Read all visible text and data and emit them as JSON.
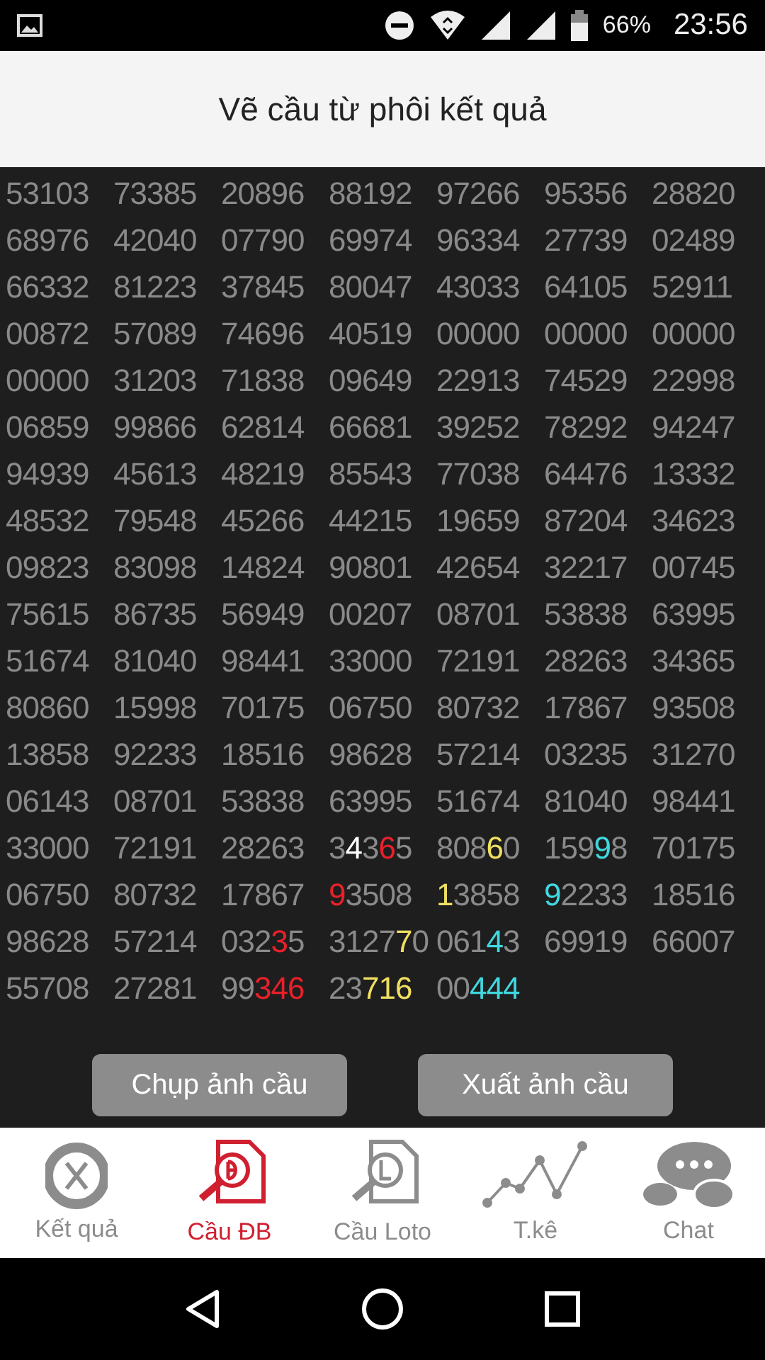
{
  "status_bar": {
    "battery": "66%",
    "time": "23:56"
  },
  "header": {
    "title": "Vẽ cầu từ phôi kết quả"
  },
  "grid": {
    "rows": [
      [
        "53103",
        "73385",
        "20896",
        "88192",
        "97266",
        "95356",
        "28820"
      ],
      [
        "68976",
        "42040",
        "07790",
        "69974",
        "96334",
        "27739",
        "02489"
      ],
      [
        "66332",
        "81223",
        "37845",
        "80047",
        "43033",
        "64105",
        "52911"
      ],
      [
        "00872",
        "57089",
        "74696",
        "40519",
        "00000",
        "00000",
        "00000"
      ],
      [
        "00000",
        "31203",
        "71838",
        "09649",
        "22913",
        "74529",
        "22998"
      ],
      [
        "06859",
        "99866",
        "62814",
        "66681",
        "39252",
        "78292",
        "94247"
      ],
      [
        "94939",
        "45613",
        "48219",
        "85543",
        "77038",
        "64476",
        "13332"
      ],
      [
        "48532",
        "79548",
        "45266",
        "44215",
        "19659",
        "87204",
        "34623"
      ],
      [
        "09823",
        "83098",
        "14824",
        "90801",
        "42654",
        "32217",
        "00745"
      ],
      [
        "75615",
        "86735",
        "56949",
        "00207",
        "08701",
        "53838",
        "63995"
      ],
      [
        "51674",
        "81040",
        "98441",
        "33000",
        "72191",
        "28263",
        "34365"
      ],
      [
        "80860",
        "15998",
        "70175",
        "06750",
        "80732",
        "17867",
        "93508"
      ],
      [
        "13858",
        "92233",
        "18516",
        "98628",
        "57214",
        "03235",
        "31270"
      ],
      [
        "06143",
        "08701",
        "53838",
        "63995",
        "51674",
        "81040",
        "98441"
      ],
      [
        "33000",
        "72191",
        "28263",
        {
          "parts": [
            {
              "text": "3"
            },
            {
              "text": "4",
              "color": "#ffffff"
            },
            {
              "text": "3"
            },
            {
              "text": "6",
              "color": "#e8202a"
            },
            {
              "text": "5"
            }
          ]
        },
        {
          "parts": [
            {
              "text": "808"
            },
            {
              "text": "6",
              "color": "#f0e060"
            },
            {
              "text": "0"
            }
          ]
        },
        {
          "parts": [
            {
              "text": "159"
            },
            {
              "text": "9",
              "color": "#40d8e0"
            },
            {
              "text": "8"
            }
          ]
        },
        "70175"
      ],
      [
        "06750",
        "80732",
        "17867",
        {
          "parts": [
            {
              "text": "9",
              "color": "#e8202a"
            },
            {
              "text": "3508"
            }
          ]
        },
        {
          "parts": [
            {
              "text": "1",
              "color": "#f0e060"
            },
            {
              "text": "3858"
            }
          ]
        },
        {
          "parts": [
            {
              "text": "9",
              "color": "#40d8e0"
            },
            {
              "text": "2233"
            }
          ]
        },
        "18516"
      ],
      [
        "98628",
        "57214",
        {
          "parts": [
            {
              "text": "032"
            },
            {
              "text": "3",
              "color": "#e8202a"
            },
            {
              "text": "5"
            }
          ]
        },
        {
          "parts": [
            {
              "text": "3127"
            },
            {
              "text": "7",
              "color": "#f0e060"
            },
            {
              "text": "0"
            }
          ]
        },
        {
          "parts": [
            {
              "text": "061"
            },
            {
              "text": "4",
              "color": "#40d8e0"
            },
            {
              "text": "3"
            }
          ]
        },
        "69919",
        "66007"
      ],
      [
        "55708",
        "27281",
        {
          "parts": [
            {
              "text": "99"
            },
            {
              "text": "346",
              "color": "#e8202a"
            }
          ]
        },
        {
          "parts": [
            {
              "text": "23"
            },
            {
              "text": "716",
              "color": "#f0e060"
            }
          ]
        },
        {
          "parts": [
            {
              "text": "00"
            },
            {
              "text": "444",
              "color": "#40d8e0"
            }
          ]
        }
      ]
    ]
  },
  "buttons": [
    "Chụp ảnh cầu",
    "Xuất ảnh cầu"
  ],
  "tabs": [
    {
      "kind": "result",
      "label": "Kết quả",
      "selected": false
    },
    {
      "kind": "special",
      "label": "Cầu ĐB",
      "selected": true
    },
    {
      "kind": "loto",
      "label": "Cầu Loto",
      "selected": false
    },
    {
      "kind": "stats",
      "label": "T.kê",
      "selected": false
    },
    {
      "kind": "chat",
      "label": "Chat",
      "selected": false
    }
  ]
}
